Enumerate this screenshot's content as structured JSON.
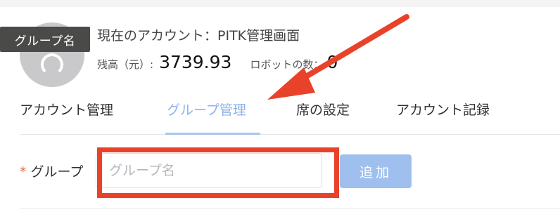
{
  "header": {
    "account_prefix": "現在のアカウント：",
    "account_name": "PITK管理画面",
    "balance_label": "残高（元）:",
    "balance_value": "3739.93",
    "robot_label": "ロボットの数：",
    "robot_value": "0"
  },
  "tooltip": {
    "text": "グループ名"
  },
  "tabs": [
    {
      "label": "アカウント管理",
      "active": false
    },
    {
      "label": "グループ管理",
      "active": true
    },
    {
      "label": "席の設定",
      "active": false
    },
    {
      "label": "アカウント記録",
      "active": false
    }
  ],
  "form": {
    "required_mark": "*",
    "group_label": "グループ",
    "group_input_placeholder": "グループ名",
    "group_input_value": "",
    "add_button_label": "追加"
  },
  "colors": {
    "active_tab": "#8db2e8",
    "button_bg": "#9fc0ee",
    "annotation": "#e8432a"
  },
  "icons": {
    "avatar": "user-avatar-icon",
    "annotation_arrow": "arrow-icon"
  }
}
